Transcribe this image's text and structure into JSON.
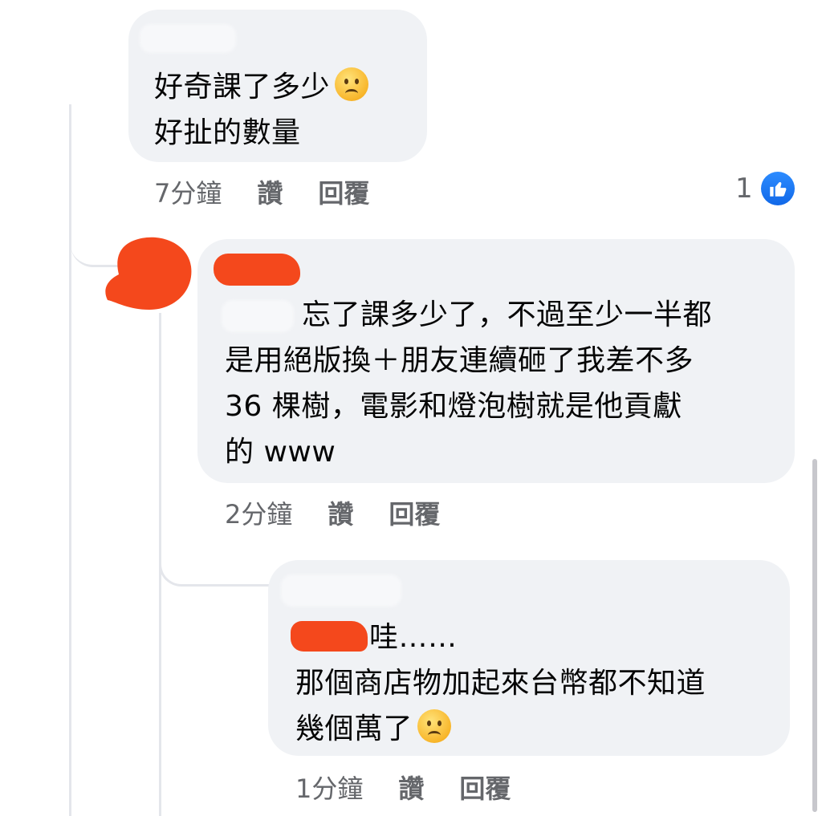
{
  "comment1": {
    "lines": [
      "好奇課了多少",
      "好扯的數量"
    ],
    "meta": {
      "time": "7分鐘",
      "like": "讚",
      "reply": "回覆"
    },
    "like_count": "1",
    "emoji": "worried-face"
  },
  "comment2": {
    "lines": [
      "忘了課多少了，不過至少一半都",
      "是用絕版換＋朋友連續砸了我差不多",
      "36 棵樹，電影和燈泡樹就是他貢獻",
      "的 www"
    ],
    "meta": {
      "time": "2分鐘",
      "like": "讚",
      "reply": "回覆"
    }
  },
  "comment3": {
    "lines": [
      "哇……",
      "那個商店物加起來台幣都不知道",
      "幾個萬了"
    ],
    "meta": {
      "time": "1分鐘",
      "like": "讚",
      "reply": "回覆"
    },
    "emoji": "worried-face"
  },
  "colors": {
    "bubble": "#f0f2f5",
    "meta": "#65676b",
    "like_blue": "#1877f2",
    "redaction": "#f4481c"
  }
}
